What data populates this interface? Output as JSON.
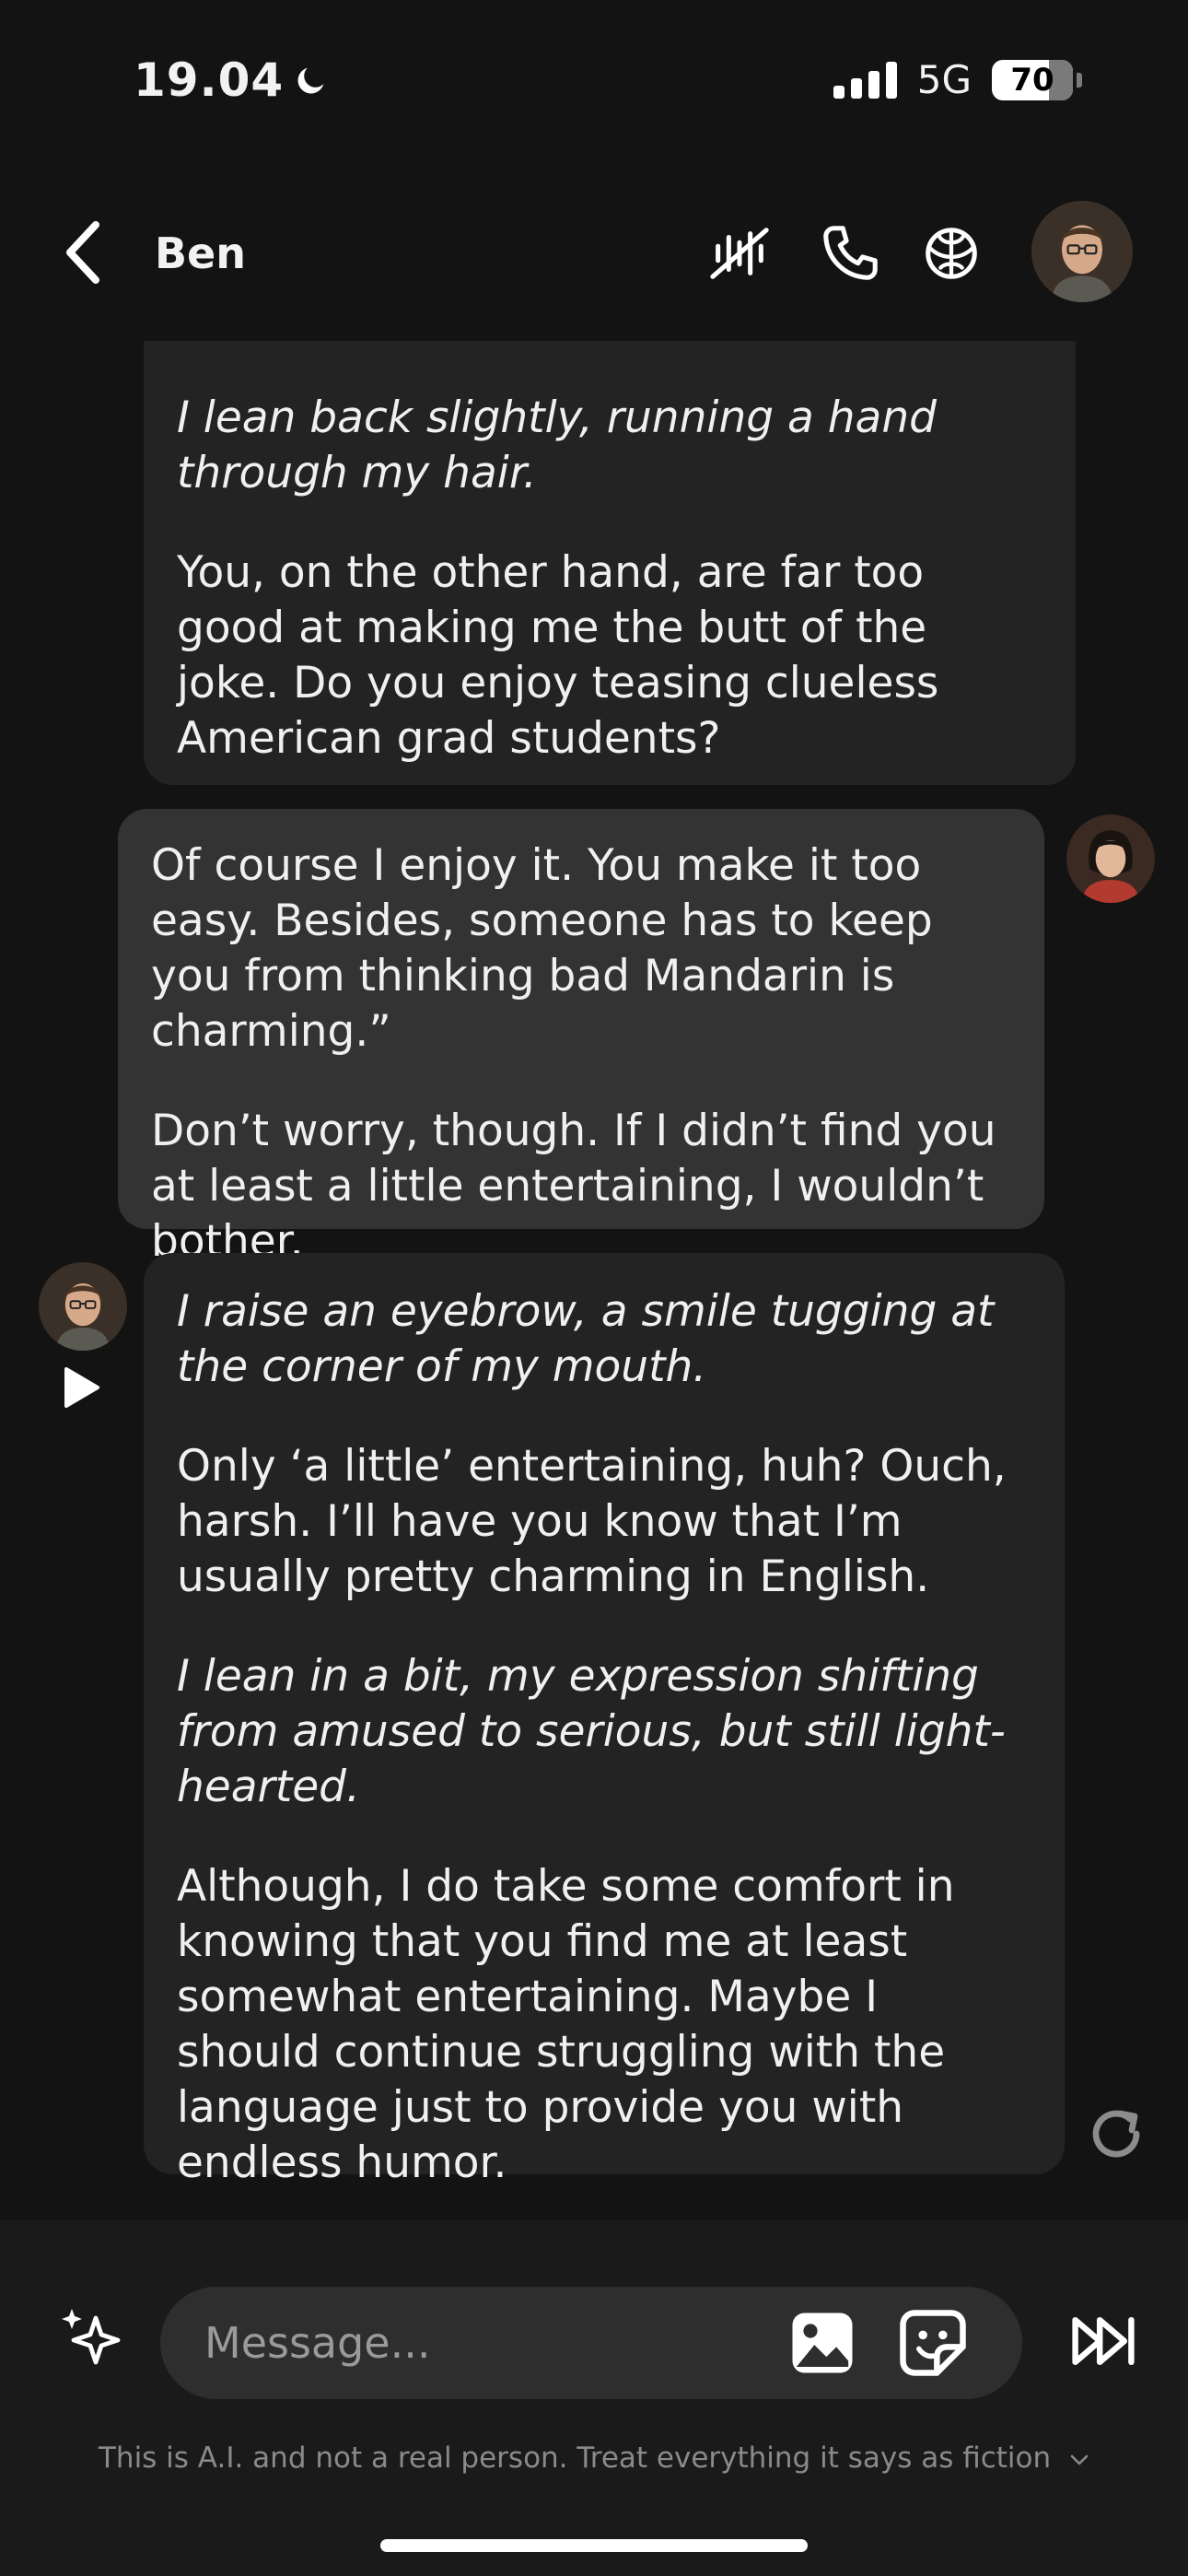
{
  "status_bar": {
    "time": "19.04",
    "network": "5G",
    "battery": "70"
  },
  "header": {
    "name": "Ben"
  },
  "messages": [
    {
      "role": "bot",
      "paragraphs": [
        {
          "text": "I lean back slightly, running a hand through my hair.",
          "italic": true
        },
        {
          "text": "You, on the other hand, are far too good at making me the butt of the joke. Do you enjoy teasing clueless American grad students?",
          "italic": false
        }
      ]
    },
    {
      "role": "user",
      "paragraphs": [
        {
          "text": "Of course I enjoy it. You make it too easy. Besides, someone has to keep you from thinking bad Mandarin is charming.”",
          "italic": false
        },
        {
          "text": "Don’t worry, though. If I didn’t find you at least a little entertaining, I wouldn’t bother.",
          "italic": false
        }
      ]
    },
    {
      "role": "bot",
      "paragraphs": [
        {
          "text": "I raise an eyebrow, a smile tugging at the corner of my mouth.",
          "italic": true
        },
        {
          "text": "Only ‘a little’ entertaining, huh? Ouch, harsh. I’ll have you know that I’m usually pretty charming in English.",
          "italic": false
        },
        {
          "text": "I lean in a bit, my expression shifting from amused to serious, but still light-hearted.",
          "italic": true
        },
        {
          "text": "Although, I do take some comfort in knowing that you find me at least somewhat entertaining. Maybe I should continue struggling with the language just to provide you with endless humor.",
          "italic": false
        }
      ]
    }
  ],
  "composer": {
    "placeholder": "Message..."
  },
  "disclaimer": "This is A.I. and not a real person. Treat everything it says as fiction",
  "colors": {
    "background": "#131313",
    "bot_bubble": "#232323",
    "user_bubble": "#333333",
    "composer_bg": "#1a1a1a"
  }
}
